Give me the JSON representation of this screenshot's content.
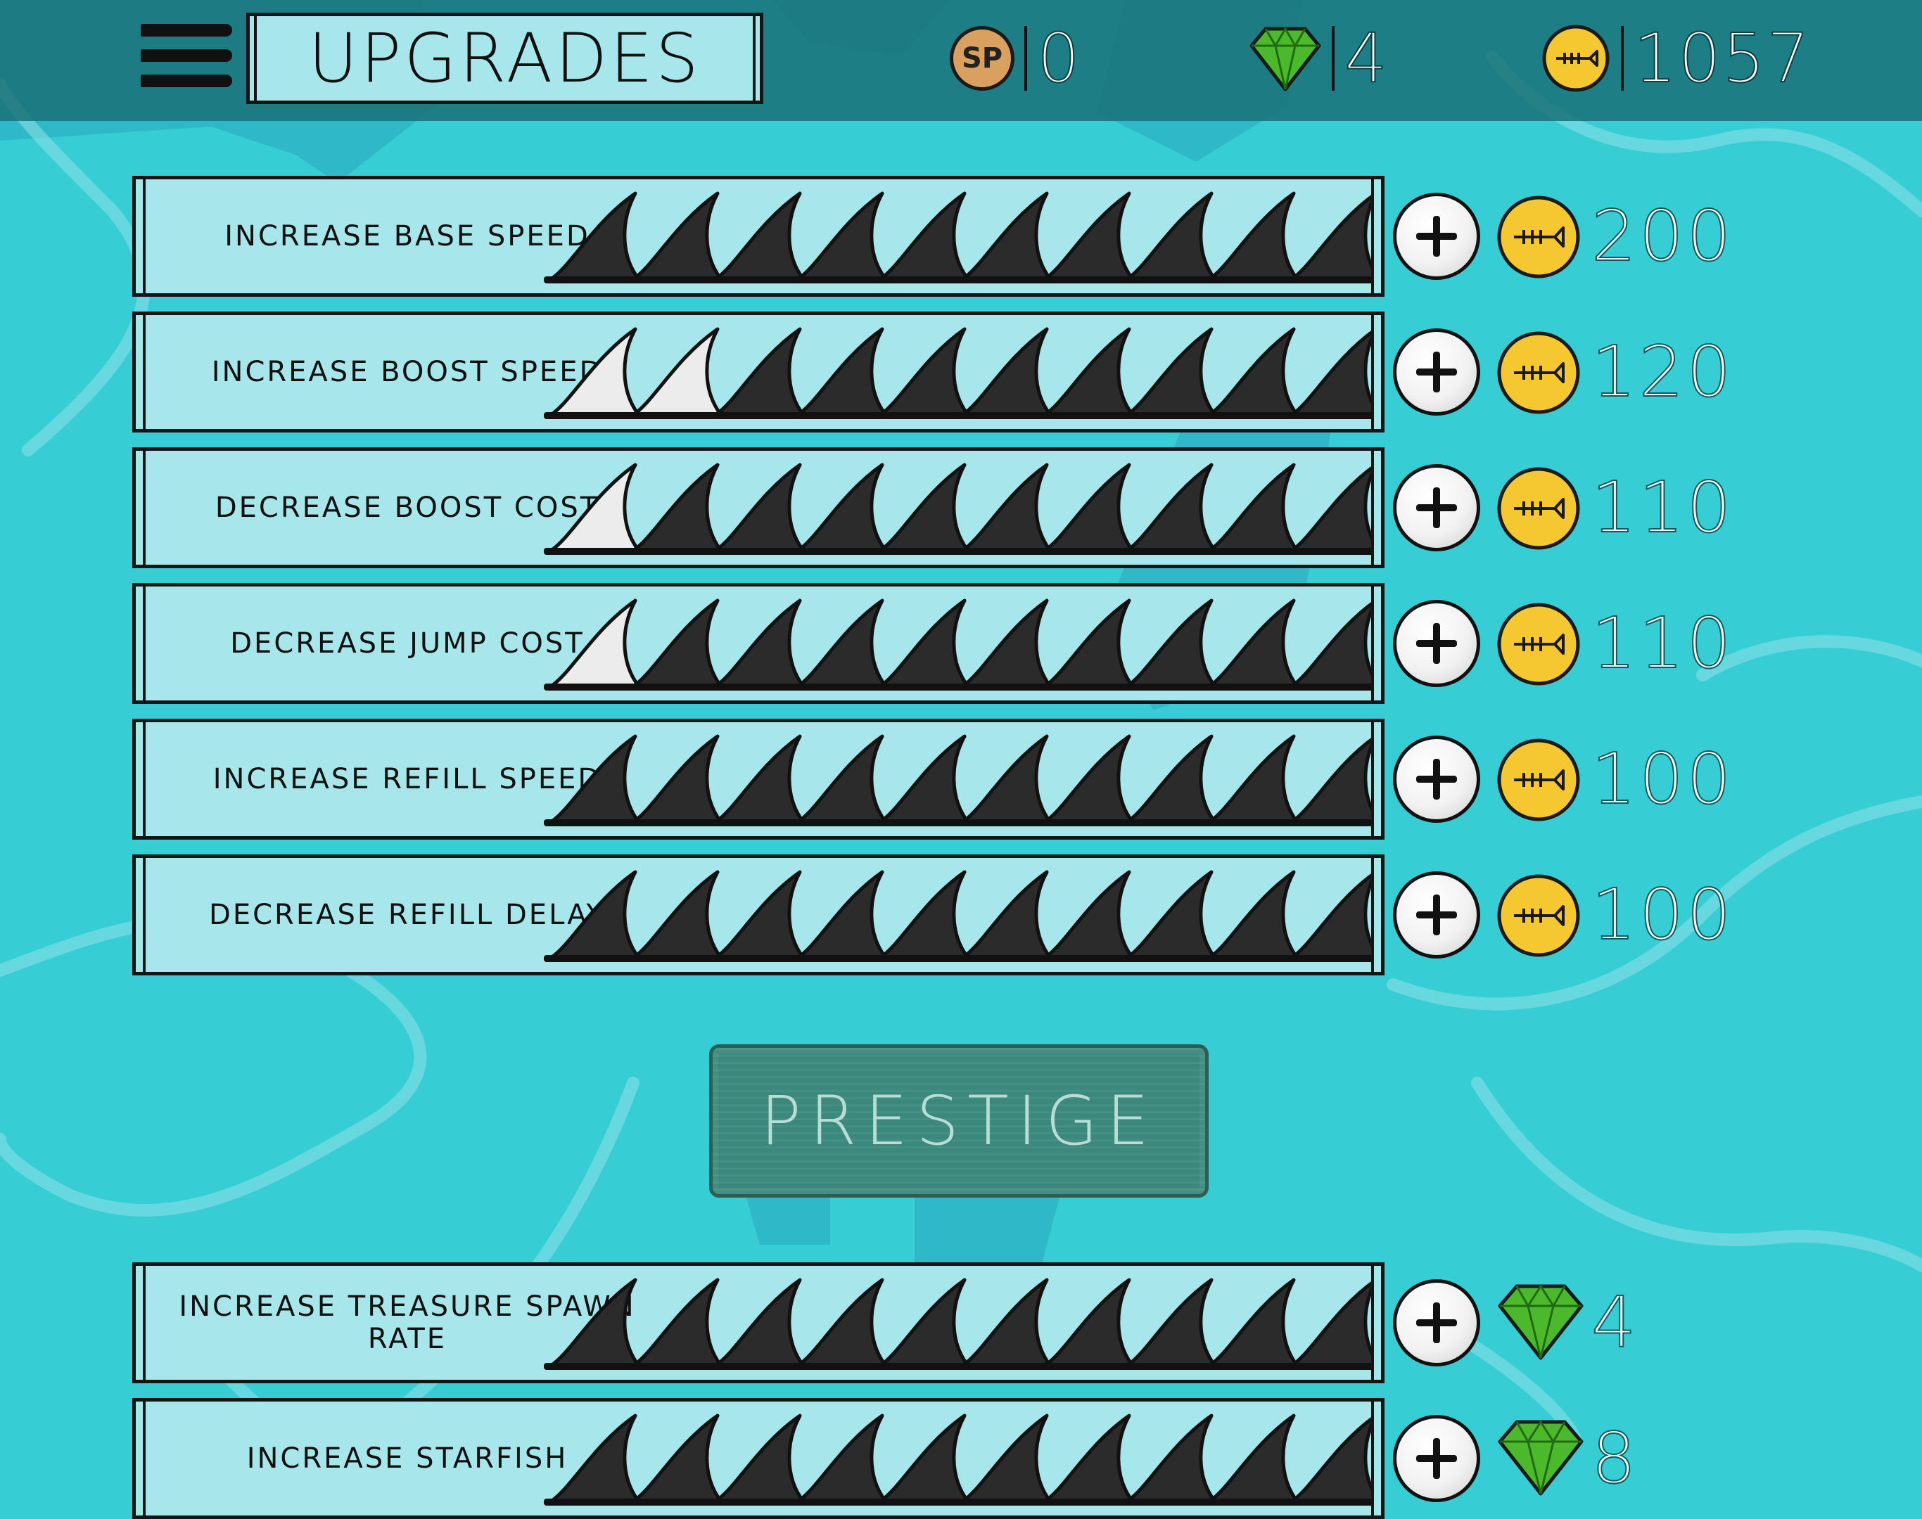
{
  "header": {
    "title": "UPGRADES",
    "skill_points": "0",
    "gems": "4",
    "coins": "1057"
  },
  "upgrades": [
    {
      "label": "INCREASE BASE SPEED",
      "level": 0,
      "max_level": 10,
      "cost": "200",
      "currency": "coin"
    },
    {
      "label": "INCREASE BOOST SPEED",
      "level": 2,
      "max_level": 10,
      "cost": "120",
      "currency": "coin"
    },
    {
      "label": "DECREASE BOOST COST",
      "level": 1,
      "max_level": 10,
      "cost": "110",
      "currency": "coin"
    },
    {
      "label": "DECREASE JUMP COST",
      "level": 1,
      "max_level": 10,
      "cost": "110",
      "currency": "coin"
    },
    {
      "label": "INCREASE REFILL SPEED",
      "level": 0,
      "max_level": 10,
      "cost": "100",
      "currency": "coin"
    },
    {
      "label": "DECREASE REFILL DELAY",
      "level": 0,
      "max_level": 10,
      "cost": "100",
      "currency": "coin"
    }
  ],
  "prestige": {
    "label": "PRESTIGE"
  },
  "gem_upgrades": [
    {
      "label": "INCREASE TREASURE SPAWN RATE",
      "level": 0,
      "max_level": 10,
      "cost": "4",
      "currency": "gem"
    },
    {
      "label": "INCREASE STARFISH",
      "level": 0,
      "max_level": 10,
      "cost": "8",
      "currency": "gem"
    }
  ],
  "colors": {
    "water": "#36cdd4",
    "panel": "#a7e6ea",
    "fin_filled": "#ececec",
    "fin_empty": "#2b2b2b",
    "coin": "#f5c832",
    "gem": "#4cb82c",
    "prestige": "#3f8c80"
  },
  "icons": {
    "menu": "hamburger-menu-icon",
    "skill_points": "sp-coin-icon",
    "gem": "green-gem-icon",
    "coin": "fishbone-coin-icon",
    "add": "plus-icon",
    "progress": "shark-fin-icon"
  }
}
